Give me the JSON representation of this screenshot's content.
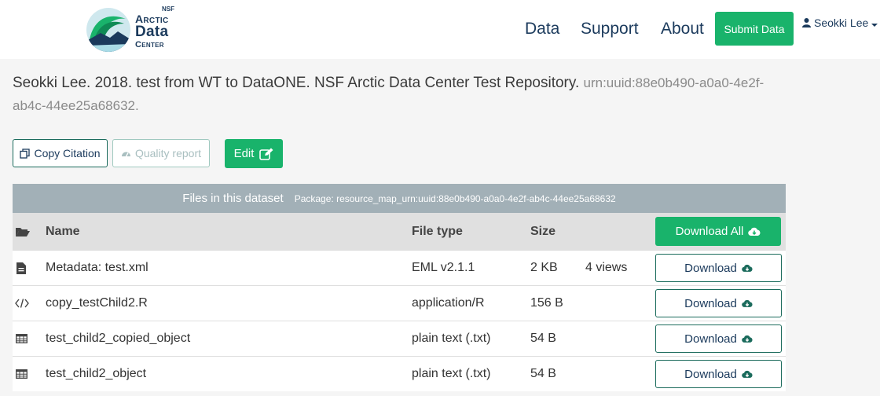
{
  "header": {
    "logo": {
      "nsf": "NSF",
      "line1": "Arctic",
      "line2": "Data",
      "line3": "Center"
    },
    "nav": [
      {
        "label": "Data"
      },
      {
        "label": "Support"
      },
      {
        "label": "About"
      }
    ],
    "submit_label": "Submit Data",
    "user_name": "Seokki Lee"
  },
  "citation": {
    "text": "Seokki Lee. 2018. test from WT to DataONE. NSF Arctic Data Center Test Repository.",
    "identifier": "urn:uuid:88e0b490-a0a0-4e2f-ab4c-44ee25a68632."
  },
  "actions": {
    "copy_citation": "Copy Citation",
    "quality_report": "Quality report",
    "edit": "Edit"
  },
  "files_table": {
    "title": "Files in this dataset",
    "package": "Package: resource_map_urn:uuid:88e0b490-a0a0-4e2f-ab4c-44ee25a68632",
    "columns": {
      "name": "Name",
      "type": "File type",
      "size": "Size"
    },
    "download_all": "Download All",
    "rows": [
      {
        "icon": "file-text-icon",
        "name": "Metadata: test.xml",
        "type": "EML v2.1.1",
        "size": "2 KB",
        "views": "4 views",
        "download": "Download"
      },
      {
        "icon": "code-icon",
        "name": "copy_testChild2.R",
        "type": "application/R",
        "size": "156 B",
        "views": "",
        "download": "Download"
      },
      {
        "icon": "table-icon",
        "name": "test_child2_copied_object",
        "type": "plain text (.txt)",
        "size": "54 B",
        "views": "",
        "download": "Download"
      },
      {
        "icon": "table-icon",
        "name": "test_child2_object",
        "type": "plain text (.txt)",
        "size": "54 B",
        "views": "",
        "download": "Download"
      }
    ]
  },
  "colors": {
    "brand_green": "#19b36b",
    "navy": "#1b3a5c",
    "table_header": "#a2b0b7"
  }
}
